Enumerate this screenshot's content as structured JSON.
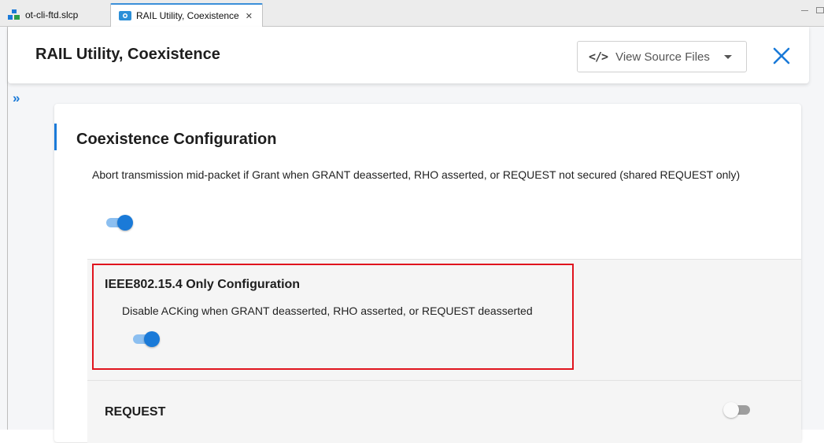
{
  "tabs": [
    {
      "label": "ot-cli-ftd.slcp",
      "icon": "project-icon",
      "active": false
    },
    {
      "label": "RAIL Utility, Coexistence",
      "icon": "component-icon",
      "active": true
    }
  ],
  "header": {
    "title": "RAIL Utility, Coexistence",
    "view_source_label": "View Source Files"
  },
  "section": {
    "title": "Coexistence Configuration",
    "abort_option": {
      "label": "Abort transmission mid-packet if Grant when GRANT deasserted, RHO asserted, or REQUEST not secured (shared REQUEST only)",
      "enabled": true
    }
  },
  "ieee_section": {
    "title": "IEEE802.15.4 Only Configuration",
    "ack_option": {
      "label": "Disable ACKing when GRANT deasserted, RHO asserted, or REQUEST deasserted",
      "enabled": true
    }
  },
  "request_section": {
    "title": "REQUEST",
    "enabled": false
  },
  "colors": {
    "accent": "#1a7ad8",
    "highlight": "#e0141e"
  }
}
